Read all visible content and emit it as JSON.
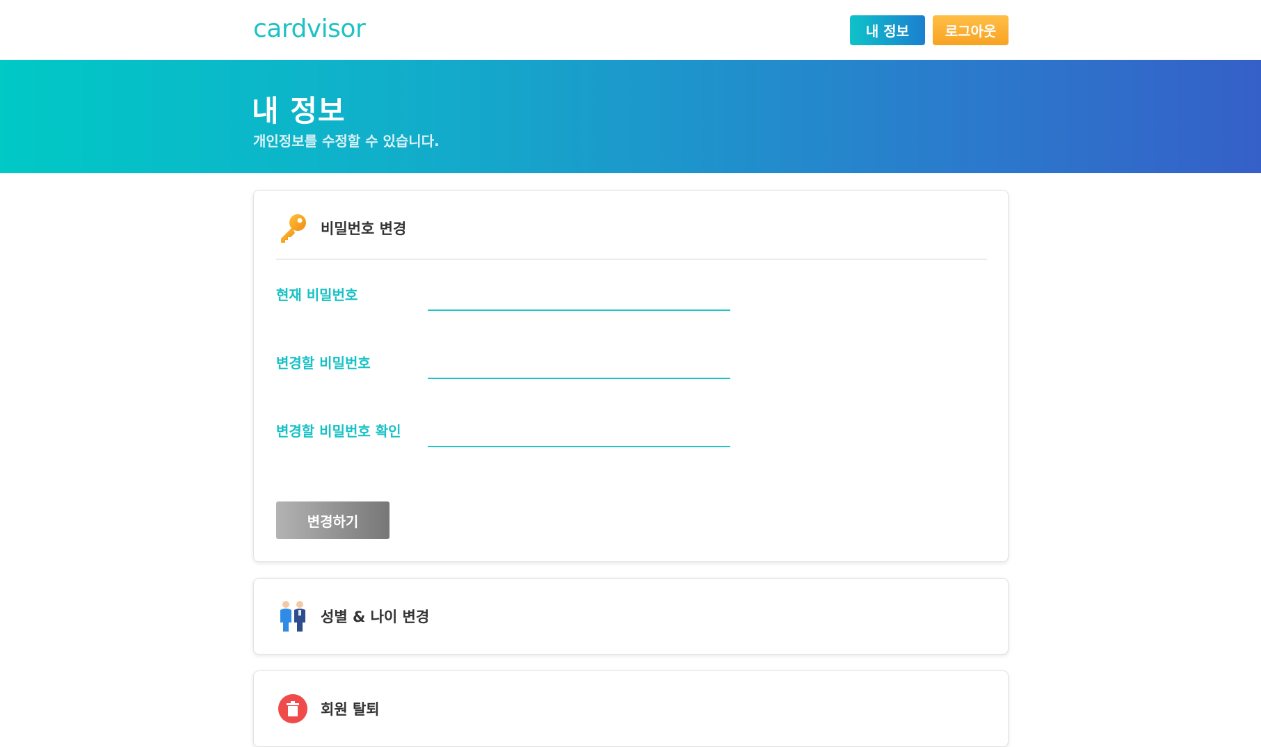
{
  "header": {
    "logo": "cardvisor",
    "myinfo_label": "내 정보",
    "logout_label": "로그아웃"
  },
  "banner": {
    "title": "내 정보",
    "subtitle": "개인정보를 수정할 수 있습니다."
  },
  "password_card": {
    "icon": "key-icon",
    "title": "비밀번호 변경",
    "fields": [
      {
        "label": "현재 비밀번호",
        "value": "",
        "placeholder": ""
      },
      {
        "label": "변경할 비밀번호",
        "value": "",
        "placeholder": ""
      },
      {
        "label": "변경할 비밀번호 확인",
        "value": "",
        "placeholder": ""
      }
    ],
    "submit_label": "변경하기"
  },
  "gender_card": {
    "icon": "people-icon",
    "title": "성별 & 나이 변경"
  },
  "withdraw_card": {
    "icon": "trash-icon",
    "title": "회원 탈퇴"
  },
  "colors": {
    "accent": "#1fc2c4",
    "logout": "#f8a323",
    "banner_start": "#00c9c6",
    "banner_end": "#3560c8"
  }
}
